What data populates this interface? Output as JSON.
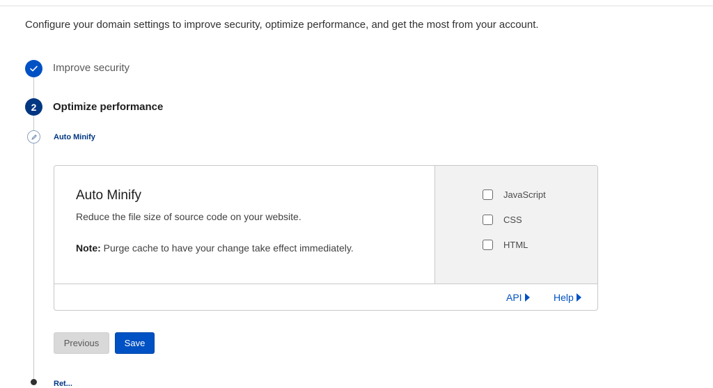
{
  "intro_text": "Configure your domain settings to improve security, optimize performance, and get the most from your account.",
  "steps": [
    {
      "number": "",
      "label": "Improve security",
      "status": "complete",
      "icon": "checkmark-icon"
    },
    {
      "number": "2",
      "label": "Optimize performance",
      "status": "current"
    }
  ],
  "substep": {
    "label": "Auto Minify",
    "icon": "pencil-icon"
  },
  "card": {
    "title": "Auto Minify",
    "description": "Reduce the file size of source code on your website.",
    "note_bold": "Note:",
    "note_text": " Purge cache to have your change take effect immediately.",
    "options": [
      {
        "label": "JavaScript",
        "checked": false
      },
      {
        "label": "CSS",
        "checked": false
      },
      {
        "label": "HTML",
        "checked": false
      }
    ],
    "footer_links": [
      "API",
      "Help"
    ]
  },
  "buttons": {
    "previous": "Previous",
    "save": "Save"
  },
  "next_step_label": "Ret...",
  "colors": {
    "primary": "#0051c3",
    "dark_navy": "#003682",
    "panel_gray": "#f2f2f2"
  }
}
